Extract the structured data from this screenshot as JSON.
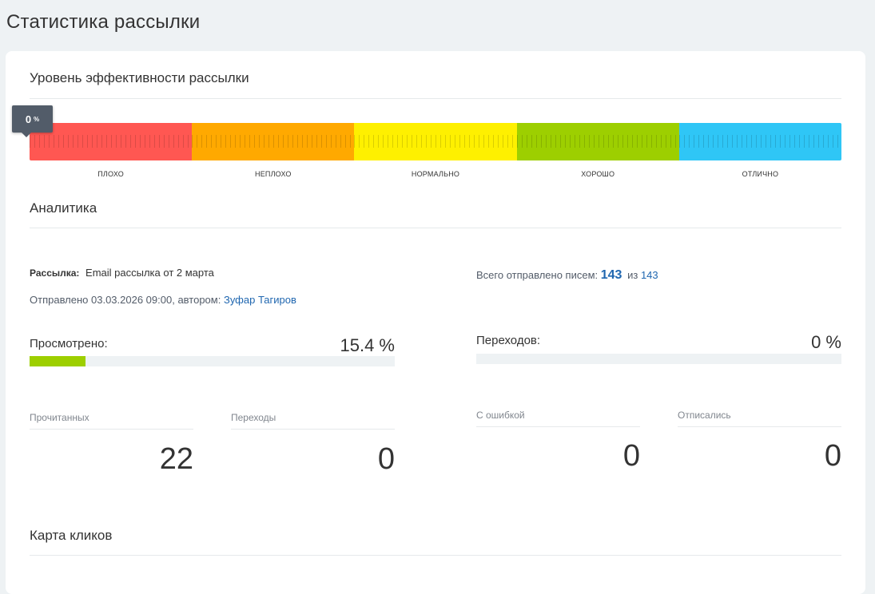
{
  "page": {
    "title": "Статистика рассылки"
  },
  "efficiency": {
    "title": "Уровень эффективности рассылки",
    "marker_value": "0",
    "marker_unit": "%",
    "segments": [
      {
        "label": "ПЛОХО",
        "color": "#ff5752"
      },
      {
        "label": "НЕПЛОХО",
        "color": "#ffa900"
      },
      {
        "label": "НОРМАЛЬНО",
        "color": "#fef000"
      },
      {
        "label": "ХОРОШО",
        "color": "#9dcf00"
      },
      {
        "label": "ОТЛИЧНО",
        "color": "#2fc6f6"
      }
    ]
  },
  "analytics": {
    "title": "Аналитика",
    "mailing_label": "Рассылка:",
    "mailing_name": "Email рассылка от 2 марта",
    "sent_prefix": "Отправлено 03.03.2026 09:00, автором:",
    "author": "Зуфар Тагиров",
    "total_prefix": "Всего отправлено писем:",
    "total_sent": "143",
    "total_of": "из",
    "total_all": "143",
    "viewed_label": "Просмотрено:",
    "viewed_value": "15.4 %",
    "viewed_fraction": 0.154,
    "clicks_label": "Переходов:",
    "clicks_value": "0 %",
    "clicks_fraction": 0,
    "stats": [
      {
        "label": "Прочитанных",
        "value": "22"
      },
      {
        "label": "Переходы",
        "value": "0"
      },
      {
        "label": "С ошибкой",
        "value": "0"
      },
      {
        "label": "Отписались",
        "value": "0"
      }
    ]
  },
  "click_map": {
    "title": "Карта кликов"
  }
}
